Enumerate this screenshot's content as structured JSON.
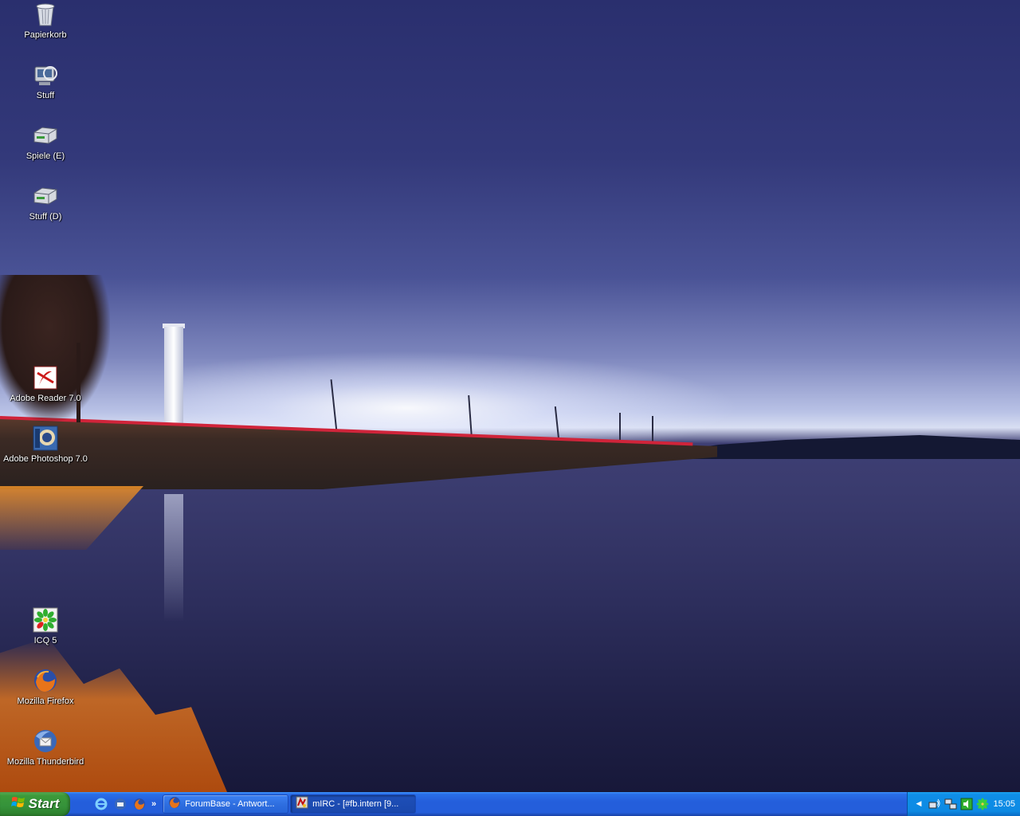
{
  "desktop_icons": [
    {
      "label": "Papierkorb",
      "icon": "recycle-bin-icon"
    },
    {
      "label": "Stuff",
      "icon": "network-drive-icon"
    },
    {
      "label": "Spiele (E)",
      "icon": "hard-drive-icon"
    },
    {
      "label": "Stuff (D)",
      "icon": "hard-drive-icon"
    },
    {
      "label": "Adobe Reader 7.0",
      "icon": "adobe-reader-icon"
    },
    {
      "label": "Adobe Photoshop 7.0",
      "icon": "photoshop-icon"
    },
    {
      "label": "ICQ 5",
      "icon": "icq-icon"
    },
    {
      "label": "Mozilla Firefox",
      "icon": "firefox-icon"
    },
    {
      "label": "Mozilla Thunderbird",
      "icon": "thunderbird-icon"
    }
  ],
  "taskbar": {
    "start_label": "Start",
    "quicklaunch": [
      "internet-explorer-icon",
      "thunderbird-icon",
      "firefox-icon"
    ],
    "quicklaunch_more": "»",
    "tasks": [
      {
        "label": "ForumBase - Antwort...",
        "icon": "firefox-icon",
        "active": false
      },
      {
        "label": "mIRC - [#fb.intern [9...",
        "icon": "mirc-icon",
        "active": true
      }
    ],
    "tray": {
      "expand_glyph": "◀",
      "icons": [
        "wireless-network-icon",
        "network-icon",
        "volume-icon",
        "icq-tray-icon"
      ],
      "clock": "15:05"
    }
  },
  "colors": {
    "taskbar": "#245edb",
    "start_button": "#3c9a3a",
    "tray": "#0d8ae3"
  }
}
